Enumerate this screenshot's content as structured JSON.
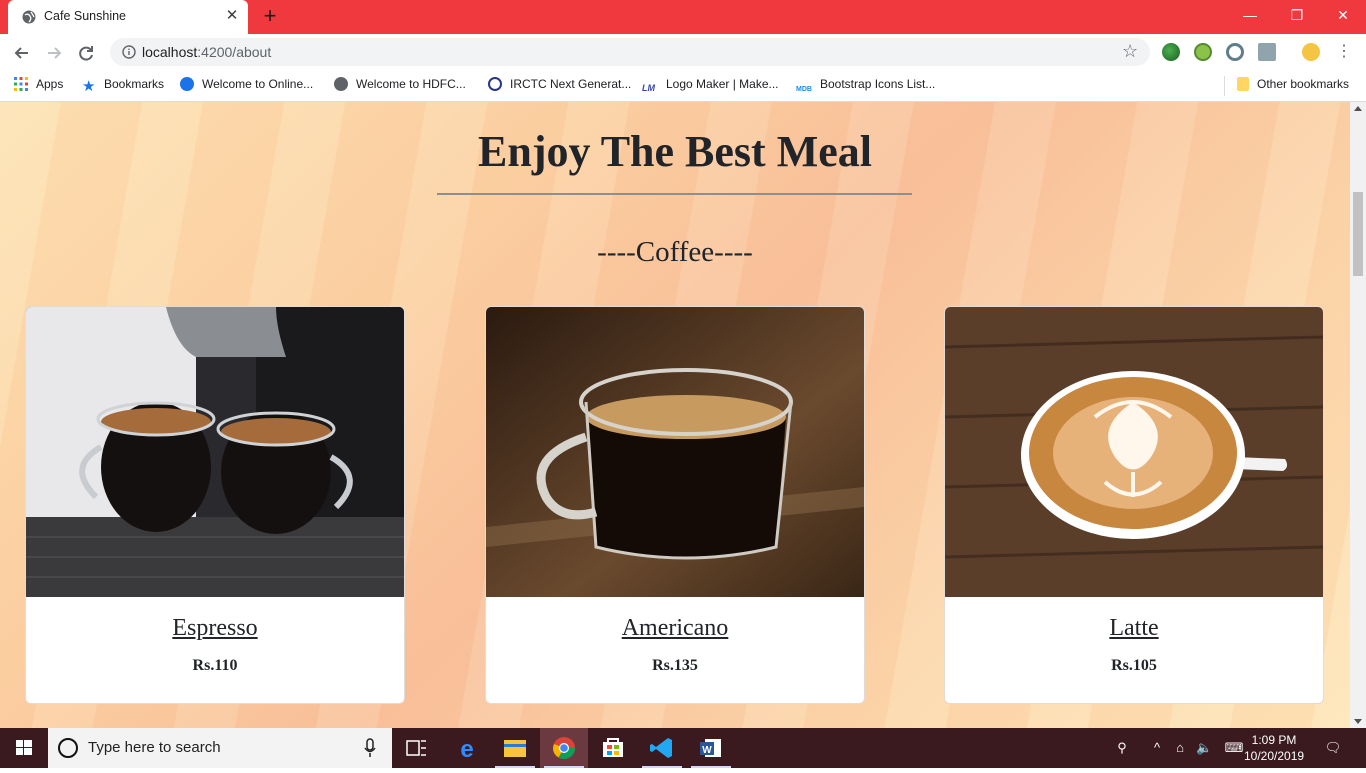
{
  "browser": {
    "tab_title": "Cafe Sunshine",
    "url_host": "localhost",
    "url_path": ":4200/about"
  },
  "bookmarks": [
    {
      "label": "Apps",
      "icon": "apps-grid-icon"
    },
    {
      "label": "Bookmarks",
      "icon": "star-icon"
    },
    {
      "label": "Welcome to Online...",
      "icon": "globe-blue-icon"
    },
    {
      "label": "Welcome to HDFC...",
      "icon": "globe-icon"
    },
    {
      "label": "IRCTC Next Generat...",
      "icon": "irctc-icon"
    },
    {
      "label": "Logo Maker | Make...",
      "icon": "lm-icon"
    },
    {
      "label": "Bootstrap Icons List...",
      "icon": "mdb-icon"
    },
    {
      "label": "Other bookmarks",
      "icon": "folder-icon"
    }
  ],
  "page": {
    "heading": "Enjoy The Best Meal",
    "subheading": "----Coffee----",
    "items": [
      {
        "name": "Espresso",
        "price": "Rs.110"
      },
      {
        "name": "Americano",
        "price": "Rs.135"
      },
      {
        "name": "Latte",
        "price": "Rs.105"
      }
    ]
  },
  "taskbar": {
    "search_placeholder": "Type here to search",
    "time": "1:09 PM",
    "date": "10/20/2019"
  },
  "colors": {
    "titlebar": "#f0383f",
    "taskbar": "#3a1a1f"
  }
}
